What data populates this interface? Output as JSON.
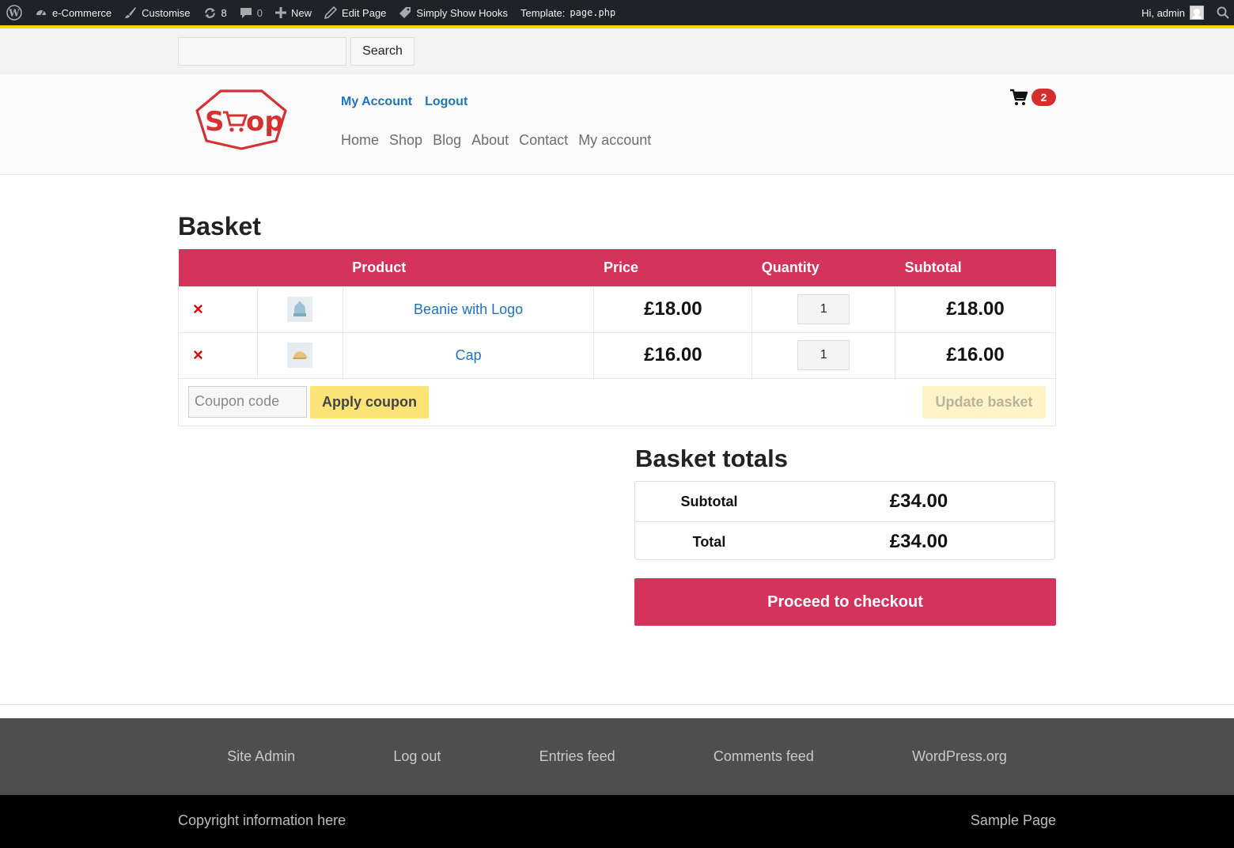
{
  "adminbar": {
    "site_name": "e-Commerce",
    "customise": "Customise",
    "updates_count": "8",
    "comments_count": "0",
    "new_label": "New",
    "edit_page": "Edit Page",
    "hooks": "Simply Show Hooks",
    "template_label": "Template:",
    "template_file": "page.php",
    "greeting": "Hi, admin"
  },
  "search": {
    "button_label": "Search",
    "placeholder": ""
  },
  "header": {
    "logo_text": "Shop",
    "top_links": [
      "My Account",
      "Logout"
    ],
    "nav": [
      "Home",
      "Shop",
      "Blog",
      "About",
      "Contact",
      "My account"
    ],
    "cart_count": "2"
  },
  "basket": {
    "title": "Basket",
    "columns": {
      "product": "Product",
      "price": "Price",
      "quantity": "Quantity",
      "subtotal": "Subtotal"
    },
    "remove_symbol": "×",
    "items": [
      {
        "name": "Beanie with Logo",
        "price": "£18.00",
        "quantity": "1",
        "subtotal": "£18.00"
      },
      {
        "name": "Cap",
        "price": "£16.00",
        "quantity": "1",
        "subtotal": "£16.00"
      }
    ],
    "coupon_placeholder": "Coupon code",
    "apply_coupon": "Apply coupon",
    "update_basket": "Update basket"
  },
  "totals": {
    "title": "Basket totals",
    "subtotal_label": "Subtotal",
    "subtotal_value": "£34.00",
    "total_label": "Total",
    "total_value": "£34.00",
    "checkout": "Proceed to checkout"
  },
  "footer": {
    "links": [
      "Site Admin",
      "Log out",
      "Entries feed",
      "Comments feed",
      "WordPress.org"
    ],
    "copyright": "Copyright information here",
    "sample_page": "Sample Page"
  },
  "colors": {
    "accent": "#d4335c",
    "link": "#1e73be",
    "coupon_button": "#fde477",
    "admin_bar": "#1d2327",
    "admin_bar_line": "#fcd600"
  }
}
